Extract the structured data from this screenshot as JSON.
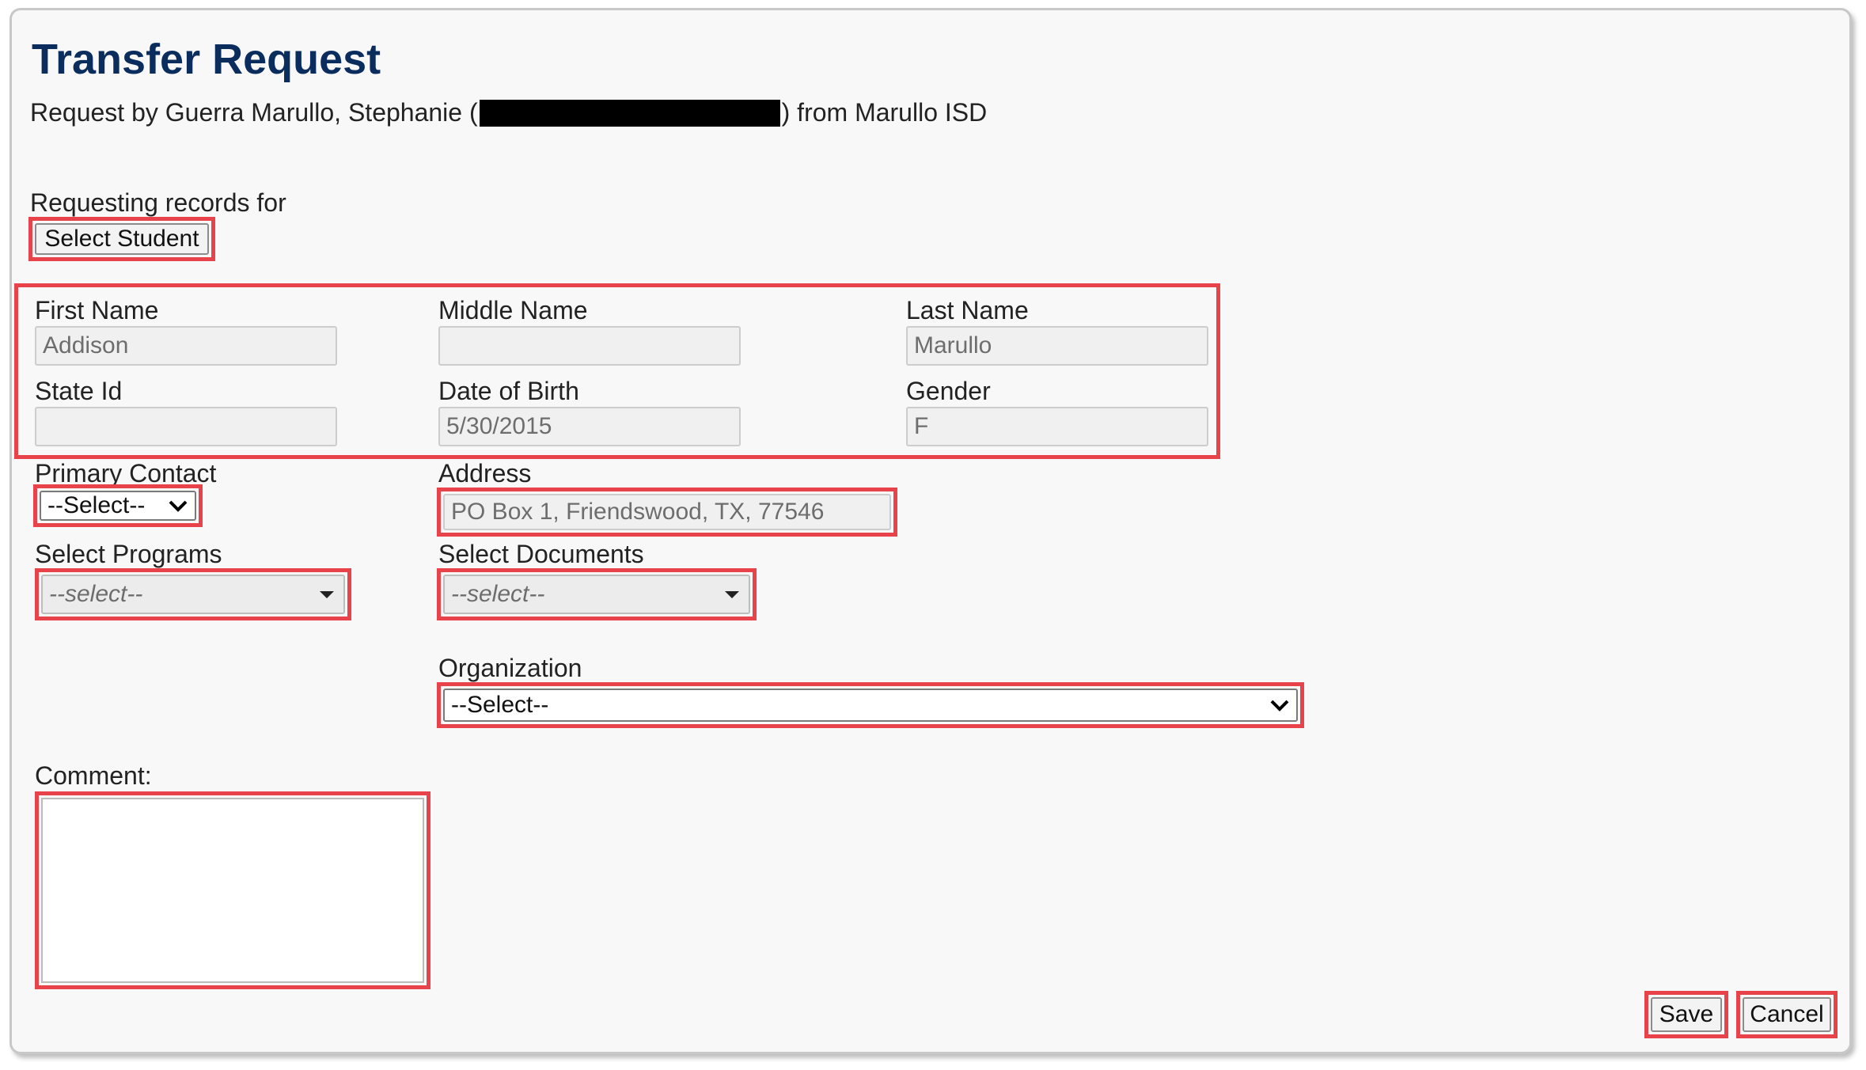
{
  "header": {
    "title": "Transfer Request",
    "request_by_prefix": "Request by Guerra Marullo, Stephanie (",
    "request_by_suffix": ") from Marullo ISD"
  },
  "student": {
    "section_label": "Requesting records for",
    "select_button": "Select Student"
  },
  "fields": {
    "first_name": {
      "label": "First Name",
      "value": "Addison"
    },
    "middle_name": {
      "label": "Middle Name",
      "value": ""
    },
    "last_name": {
      "label": "Last Name",
      "value": "Marullo"
    },
    "state_id": {
      "label": "State Id",
      "value": ""
    },
    "dob": {
      "label": "Date of Birth",
      "value": "5/30/2015"
    },
    "gender": {
      "label": "Gender",
      "value": "F"
    },
    "primary_contact": {
      "label": "Primary Contact",
      "value": "--Select--"
    },
    "address": {
      "label": "Address",
      "value": "PO Box 1, Friendswood, TX, 77546"
    },
    "programs": {
      "label": "Select Programs",
      "value": "--select--"
    },
    "documents": {
      "label": "Select Documents",
      "value": "--select--"
    },
    "organization": {
      "label": "Organization",
      "value": "--Select--"
    },
    "comment": {
      "label": "Comment:",
      "value": ""
    }
  },
  "actions": {
    "save": "Save",
    "cancel": "Cancel"
  },
  "colors": {
    "title": "#0b2d5e",
    "highlight": "#e8434a"
  },
  "icons": {
    "dropdown": "chevron-down-icon",
    "dropdown_triangle": "triangle-down-icon"
  }
}
